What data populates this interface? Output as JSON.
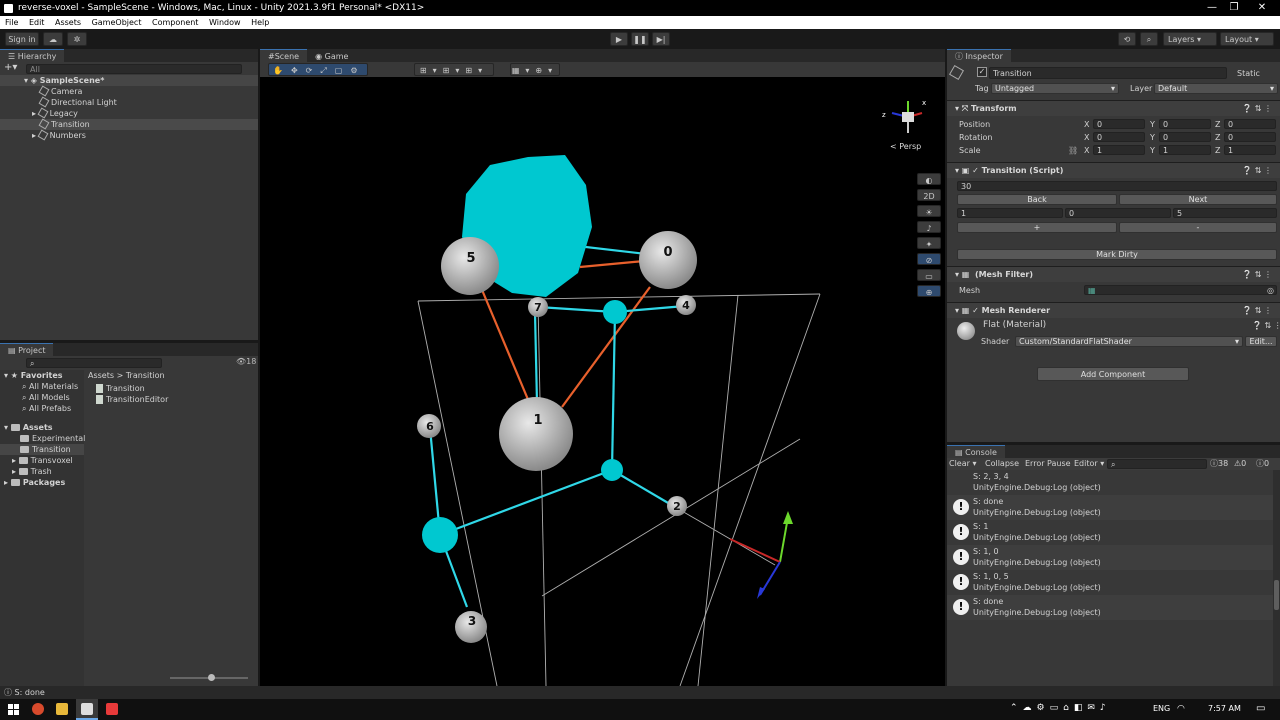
{
  "window": {
    "title": "reverse-voxel - SampleScene - Windows, Mac, Linux - Unity 2021.3.9f1 Personal* <DX11>"
  },
  "menu": [
    "File",
    "Edit",
    "Assets",
    "GameObject",
    "Component",
    "Window",
    "Help"
  ],
  "toolbar": {
    "sign_in": "Sign in",
    "layers": "Layers",
    "layout": "Layout"
  },
  "hierarchy": {
    "tab": "Hierarchy",
    "search_placeholder": "All",
    "scene": "SampleScene*",
    "items": [
      "Camera",
      "Directional Light",
      "Legacy",
      "Transition",
      "Numbers"
    ]
  },
  "scene": {
    "tab_scene": "Scene",
    "tab_game": "Game",
    "persp": "< Persp",
    "btn_2d": "2D",
    "gizmo_x": "x",
    "gizmo_z": "z"
  },
  "nodes": [
    "5",
    "0",
    "7",
    "4",
    "1",
    "6",
    "2",
    "3"
  ],
  "project": {
    "tab": "Project",
    "badge": "18",
    "favorites": "Favorites",
    "fav_items": [
      "All Materials",
      "All Models",
      "All Prefabs"
    ],
    "assets": "Assets",
    "asset_folders": [
      "Experimental",
      "Transition",
      "Transvoxel",
      "Trash"
    ],
    "packages": "Packages",
    "breadcrumb_root": "Assets",
    "breadcrumb_sep": ">",
    "breadcrumb_leaf": "Transition",
    "files": [
      "Transition",
      "TransitionEditor"
    ]
  },
  "inspector": {
    "tab": "Inspector",
    "object_name": "Transition",
    "static": "Static",
    "tag_label": "Tag",
    "tag_value": "Untagged",
    "layer_label": "Layer",
    "layer_value": "Default",
    "transform": {
      "title": "Transform",
      "position": "Position",
      "rotation": "Rotation",
      "scale": "Scale",
      "rows": [
        {
          "x": "0",
          "y": "0",
          "z": "0"
        },
        {
          "x": "0",
          "y": "0",
          "z": "0"
        },
        {
          "x": "1",
          "y": "1",
          "z": "1"
        }
      ],
      "axis_x": "X",
      "axis_y": "Y",
      "axis_z": "Z"
    },
    "script": {
      "title": "Transition (Script)",
      "value": "30",
      "back": "Back",
      "next": "Next",
      "vals": [
        "1",
        "0",
        "5"
      ],
      "plus": "+",
      "minus": "-",
      "mark_dirty": "Mark Dirty"
    },
    "mesh_filter": {
      "title": "(Mesh Filter)",
      "mesh_label": "Mesh"
    },
    "mesh_renderer": {
      "title": "Mesh Renderer"
    },
    "material": {
      "name": "Flat (Material)",
      "shader_label": "Shader",
      "shader": "Custom/StandardFlatShader",
      "edit": "Edit..."
    },
    "add_component": "Add Component"
  },
  "console": {
    "tab": "Console",
    "clear": "Clear",
    "collapse": "Collapse",
    "error_pause": "Error Pause",
    "editor": "Editor",
    "count_info": "38",
    "count_warn": "0",
    "count_err": "0",
    "partial": "S: 2, 3, 4",
    "entries": [
      {
        "msg": "UnityEngine.Debug:Log (object)"
      },
      {
        "msg": "S: done",
        "sub": "UnityEngine.Debug:Log (object)"
      },
      {
        "msg": "S: 1",
        "sub": "UnityEngine.Debug:Log (object)"
      },
      {
        "msg": "S: 1, 0",
        "sub": "UnityEngine.Debug:Log (object)"
      },
      {
        "msg": "S: 1, 0, 5",
        "sub": "UnityEngine.Debug:Log (object)"
      },
      {
        "msg": "S: done",
        "sub": "UnityEngine.Debug:Log (object)"
      }
    ]
  },
  "status": "S: done",
  "taskbar": {
    "lang": "ENG",
    "time": "7:57 AM"
  },
  "colors": {
    "accent": "#3a72b0",
    "cyan": "#00c8d0",
    "orange": "#e8602c",
    "edge_cyan": "#30d8e8"
  }
}
